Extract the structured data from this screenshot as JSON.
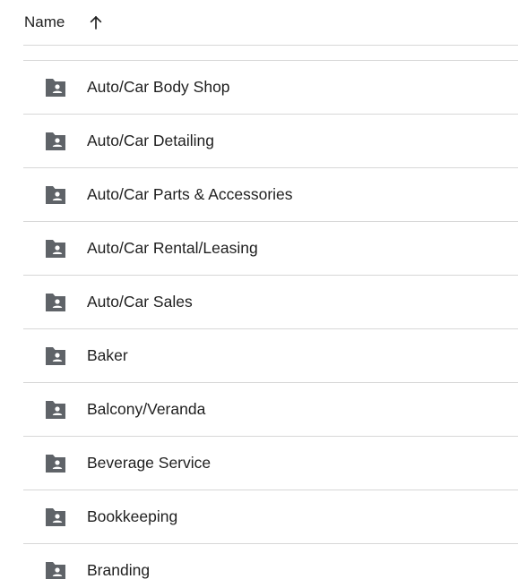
{
  "header": {
    "name_label": "Name",
    "sort_icon": "arrow-up-icon"
  },
  "colors": {
    "icon": "#5f6368",
    "text": "#1f1f1f",
    "divider": "#d7d7d7",
    "background": "#ffffff"
  },
  "folders": [
    {
      "name": "Auto/Car Body Shop",
      "icon": "shared-folder-icon"
    },
    {
      "name": "Auto/Car Detailing",
      "icon": "shared-folder-icon"
    },
    {
      "name": "Auto/Car Parts & Accessories",
      "icon": "shared-folder-icon"
    },
    {
      "name": "Auto/Car Rental/Leasing",
      "icon": "shared-folder-icon"
    },
    {
      "name": "Auto/Car Sales",
      "icon": "shared-folder-icon"
    },
    {
      "name": "Baker",
      "icon": "shared-folder-icon"
    },
    {
      "name": "Balcony/Veranda",
      "icon": "shared-folder-icon"
    },
    {
      "name": "Beverage Service",
      "icon": "shared-folder-icon"
    },
    {
      "name": "Bookkeeping",
      "icon": "shared-folder-icon"
    },
    {
      "name": "Branding",
      "icon": "shared-folder-icon"
    }
  ]
}
